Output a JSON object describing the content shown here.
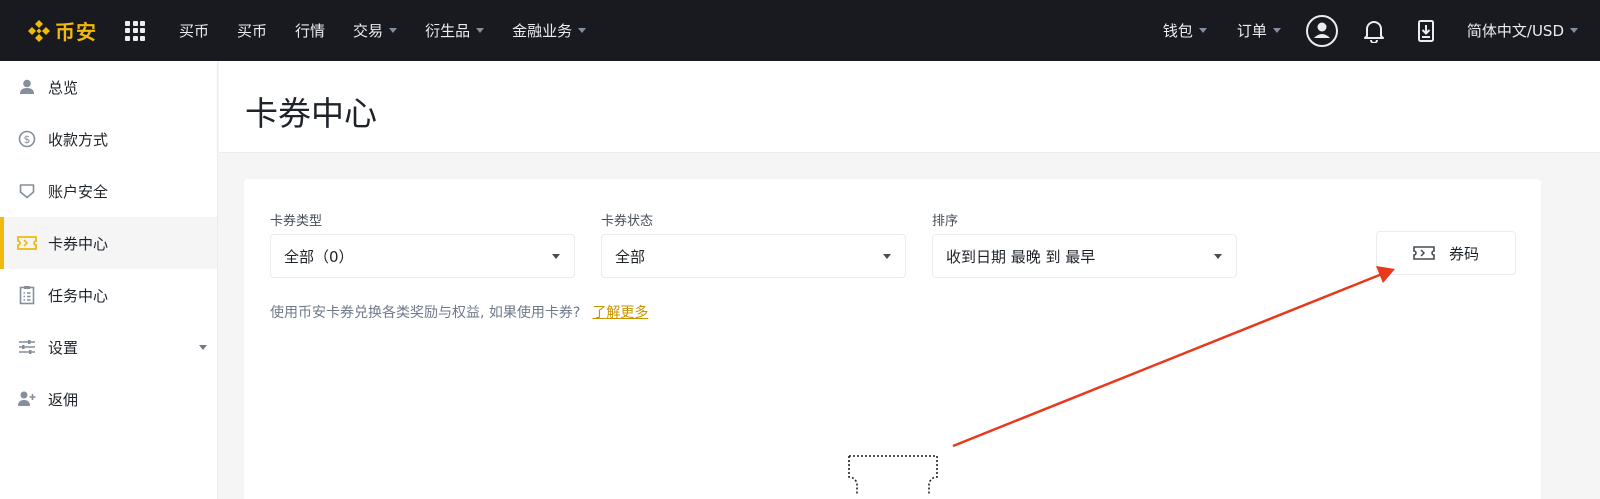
{
  "brand": {
    "name": "币安",
    "color": "#f0b90b"
  },
  "topnav": {
    "items": [
      {
        "label": "买币",
        "has_caret": false
      },
      {
        "label": "买币",
        "has_caret": false
      },
      {
        "label": "行情",
        "has_caret": false
      },
      {
        "label": "交易",
        "has_caret": true
      },
      {
        "label": "衍生品",
        "has_caret": true
      },
      {
        "label": "金融业务",
        "has_caret": true
      }
    ],
    "right": {
      "wallet": "钱包",
      "orders": "订单",
      "language": "简体中文/USD",
      "icons": [
        "user-circle-icon",
        "bell-icon",
        "download-icon"
      ]
    }
  },
  "sidebar": {
    "items": [
      {
        "label": "总览",
        "icon": "user-icon",
        "active": false
      },
      {
        "label": "收款方式",
        "icon": "dollar-circle-icon",
        "active": false
      },
      {
        "label": "账户安全",
        "icon": "shield-icon",
        "active": false
      },
      {
        "label": "卡券中心",
        "icon": "ticket-icon",
        "active": true
      },
      {
        "label": "任务中心",
        "icon": "clipboard-icon",
        "active": false
      },
      {
        "label": "设置",
        "icon": "sliders-icon",
        "active": false,
        "expandable": true
      },
      {
        "label": "返佣",
        "icon": "user-plus-icon",
        "active": false
      }
    ]
  },
  "page": {
    "title": "卡券中心",
    "filters": {
      "type": {
        "label": "卡券类型",
        "value": "全部（0）"
      },
      "status": {
        "label": "卡券状态",
        "value": "全部"
      },
      "sort": {
        "label": "排序",
        "value": "收到日期 最晚 到 最早"
      }
    },
    "code_button": "券码",
    "hint": "使用币安卡券兑换各类奖励与权益, 如果使用卡券?",
    "learn_more": "了解更多"
  },
  "colors": {
    "accent": "#f0b90b",
    "link": "#c99400",
    "annotation_arrow": "#e8391d",
    "topbar": "#181a20"
  }
}
